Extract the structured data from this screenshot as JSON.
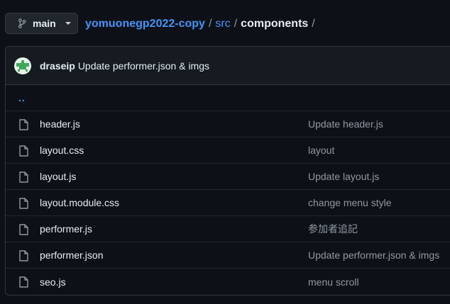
{
  "branch": {
    "label": "main"
  },
  "breadcrumb": {
    "repo": "yomuonegp2022-copy",
    "sep1": "/",
    "dir": "src",
    "sep2": "/",
    "current": "components",
    "sep3": "/"
  },
  "latest_commit": {
    "author": "draseip",
    "message": "Update performer.json & imgs"
  },
  "parent_dir": {
    "label": ".."
  },
  "files": [
    {
      "name": "header.js",
      "commit": "Update header.js"
    },
    {
      "name": "layout.css",
      "commit": "layout"
    },
    {
      "name": "layout.js",
      "commit": "Update layout.js"
    },
    {
      "name": "layout.module.css",
      "commit": "change menu style"
    },
    {
      "name": "performer.js",
      "commit": "参加者追記"
    },
    {
      "name": "performer.json",
      "commit": "Update performer.json & imgs"
    },
    {
      "name": "seo.js",
      "commit": "menu scroll"
    }
  ],
  "colors": {
    "background": "#0d1117",
    "link": "#4493f8",
    "muted": "#9198a1",
    "border": "#30363d"
  },
  "icons": {
    "branch": "git-branch-icon",
    "caret": "caret-down-icon",
    "file": "file-icon"
  }
}
